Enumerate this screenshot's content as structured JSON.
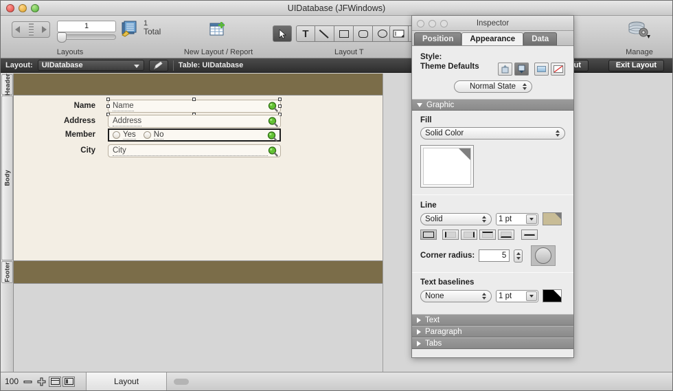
{
  "window": {
    "title": "UIDatabase (JFWindows)"
  },
  "toolbar": {
    "nav": {
      "record_number": "1",
      "total_number": "1",
      "total_label": "Total",
      "caption": "Layouts"
    },
    "new_layout": {
      "caption": "New Layout / Report"
    },
    "tools": {
      "caption": "Layout T",
      "items": [
        {
          "name": "pointer-tool",
          "glyph": "⮝"
        },
        {
          "name": "text-tool",
          "glyph": "T"
        },
        {
          "name": "line-tool",
          "glyph": ""
        },
        {
          "name": "rectangle-tool",
          "glyph": ""
        },
        {
          "name": "rounded-rectangle-tool",
          "glyph": ""
        },
        {
          "name": "oval-tool",
          "glyph": ""
        },
        {
          "name": "field-tool",
          "glyph": ""
        },
        {
          "name": "button-tool",
          "glyph": ""
        }
      ]
    },
    "manage": {
      "caption": "Manage"
    }
  },
  "layout_bar": {
    "layout_label": "Layout:",
    "layout_value": "UIDatabase",
    "table_label": "Table: UIDatabase",
    "save_layout_label": "e Layout",
    "exit_layout_label": "Exit Layout"
  },
  "canvas": {
    "parts": {
      "header": "Header",
      "body": "Body",
      "footer": "Footer"
    },
    "colors": {
      "header_fill": "#7b6d49",
      "body_fill": "#f3eee4",
      "footer_fill": "#7b6d49"
    },
    "fields": [
      {
        "label": "Name",
        "value": "Name",
        "type": "text",
        "selected": true
      },
      {
        "label": "Address",
        "value": "Address",
        "type": "text",
        "selected": false
      },
      {
        "label": "Member",
        "value": "",
        "type": "radio",
        "selected": false,
        "options": [
          "Yes",
          "No"
        ]
      },
      {
        "label": "City",
        "value": "City",
        "type": "text",
        "selected": false
      }
    ]
  },
  "status_bar": {
    "zoom_level": "100",
    "tab_label": "Layout"
  },
  "inspector": {
    "title": "Inspector",
    "tabs": [
      {
        "label": "Position",
        "active": false
      },
      {
        "label": "Appearance",
        "active": true
      },
      {
        "label": "Data",
        "active": false
      }
    ],
    "style": {
      "label": "Style:",
      "value": "Theme Defaults",
      "state_popup": "Normal State"
    },
    "sections": [
      {
        "label": "Graphic",
        "expanded": true
      },
      {
        "label": "Text",
        "expanded": false
      },
      {
        "label": "Paragraph",
        "expanded": false
      },
      {
        "label": "Tabs",
        "expanded": false
      }
    ],
    "graphic": {
      "fill": {
        "label": "Fill",
        "type_value": "Solid Color",
        "color": "#ffffff"
      },
      "line": {
        "label": "Line",
        "style_value": "Solid",
        "width_value": "1 pt",
        "color": "#c8bc96",
        "corner_radius_label": "Corner radius:",
        "corner_radius_value": "5"
      },
      "baselines": {
        "label": "Text baselines",
        "style_value": "None",
        "width_value": "1 pt",
        "color": "#000000"
      }
    }
  }
}
